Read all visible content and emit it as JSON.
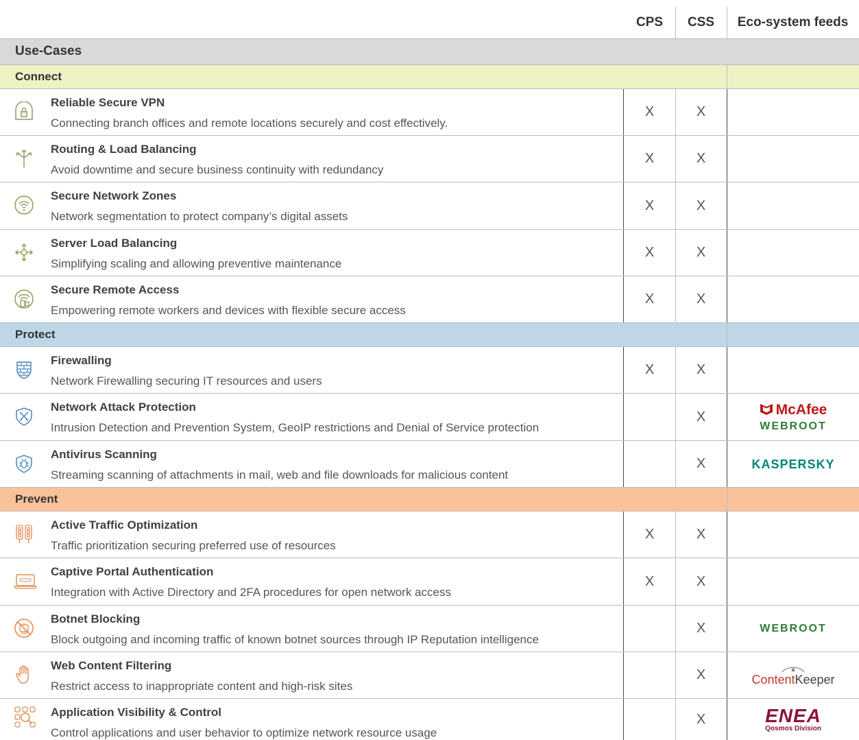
{
  "columns": {
    "cps": "CPS",
    "css": "CSS",
    "eco": "Eco-system feeds"
  },
  "use_cases_label": "Use-Cases",
  "colors": {
    "connect": "#eef1c4",
    "protect": "#bdd7e7",
    "prevent": "#f9c29a",
    "icon": "#8aa05a",
    "icon_protect": "#4a86b8",
    "icon_prevent": "#e08a4e"
  },
  "sections": [
    {
      "name": "Connect",
      "rows": [
        {
          "icon": "vpn-lock-icon",
          "title": "Reliable Secure VPN",
          "desc": "Connecting branch offices and remote locations securely and cost effectively.",
          "cps": "X",
          "css": "X",
          "eco": []
        },
        {
          "icon": "routing-arrows-icon",
          "title": "Routing & Load Balancing",
          "desc": "Avoid downtime and secure business continuity with redundancy",
          "cps": "X",
          "css": "X",
          "eco": []
        },
        {
          "icon": "wifi-zone-icon",
          "title": "Secure Network Zones",
          "desc": "Network segmentation to protect company’s digital assets",
          "cps": "X",
          "css": "X",
          "eco": []
        },
        {
          "icon": "server-balance-icon",
          "title": "Server Load Balancing",
          "desc": "Simplifying scaling and allowing preventive maintenance",
          "cps": "X",
          "css": "X",
          "eco": []
        },
        {
          "icon": "remote-access-icon",
          "title": "Secure Remote Access",
          "desc": "Empowering remote workers and devices with flexible secure access",
          "cps": "X",
          "css": "X",
          "eco": []
        }
      ]
    },
    {
      "name": "Protect",
      "rows": [
        {
          "icon": "firewall-icon",
          "title": "Firewalling",
          "desc": "Network Firewalling securing IT resources and users",
          "cps": "X",
          "css": "X",
          "eco": []
        },
        {
          "icon": "attack-shield-icon",
          "title": "Network Attack Protection",
          "desc": "Intrusion Detection and Prevention System, GeoIP restrictions and Denial of Service protection",
          "cps": "",
          "css": "X",
          "eco": [
            "McAfee",
            "WEBROOT"
          ]
        },
        {
          "icon": "antivirus-bug-icon",
          "title": "Antivirus Scanning",
          "desc": "Streaming scanning of attachments in mail, web and file downloads for malicious content",
          "cps": "",
          "css": "X",
          "eco": [
            "KASPERSKY"
          ]
        }
      ]
    },
    {
      "name": "Prevent",
      "rows": [
        {
          "icon": "traffic-light-icon",
          "title": "Active Traffic Optimization",
          "desc": "Traffic prioritization securing preferred use of resources",
          "cps": "X",
          "css": "X",
          "eco": []
        },
        {
          "icon": "captive-portal-icon",
          "title": "Captive Portal Authentication",
          "desc": "Integration with Active Directory and 2FA procedures for open network access",
          "cps": "X",
          "css": "X",
          "eco": []
        },
        {
          "icon": "botnet-block-icon",
          "title": "Botnet Blocking",
          "desc": "Block outgoing and incoming traffic of known botnet sources through IP Reputation intelligence",
          "cps": "",
          "css": "X",
          "eco": [
            "WEBROOT"
          ]
        },
        {
          "icon": "hand-stop-icon",
          "title": "Web Content Filtering",
          "desc": "Restrict access to inappropriate content and high-risk sites",
          "cps": "",
          "css": "X",
          "eco": [
            "ContentKeeper"
          ]
        },
        {
          "icon": "app-control-icon",
          "title": "Application Visibility & Control",
          "desc": "Control applications and user behavior to optimize network resource usage",
          "cps": "",
          "css": "X",
          "eco": [
            "ENEA",
            "Qosmos Division"
          ]
        }
      ]
    }
  ]
}
